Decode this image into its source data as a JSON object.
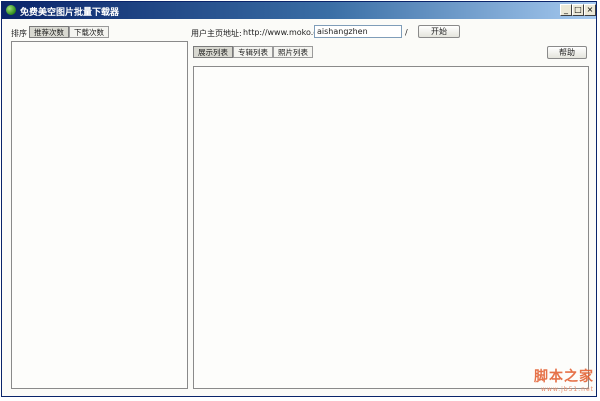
{
  "window": {
    "title": "免费美空图片批量下载器",
    "minimize_glyph": "_",
    "maximize_glyph": "□",
    "close_glyph": "×"
  },
  "sort": {
    "label": "排序",
    "tabs": [
      {
        "label": "推荐次数",
        "active": true
      },
      {
        "label": "下载次数",
        "active": false
      }
    ]
  },
  "url_bar": {
    "label": "用户主页地址:",
    "prefix": "http://www.moko.cc/",
    "value": "aishangzhen",
    "suffix": "/",
    "start_label": "开始"
  },
  "view_tabs": [
    {
      "label": "展示列表",
      "active": true
    },
    {
      "label": "专辑列表",
      "active": false
    },
    {
      "label": "照片列表",
      "active": false
    }
  ],
  "help_label": "帮助",
  "watermark": {
    "main": "脚本之家",
    "sub": "www.jb51.net"
  }
}
